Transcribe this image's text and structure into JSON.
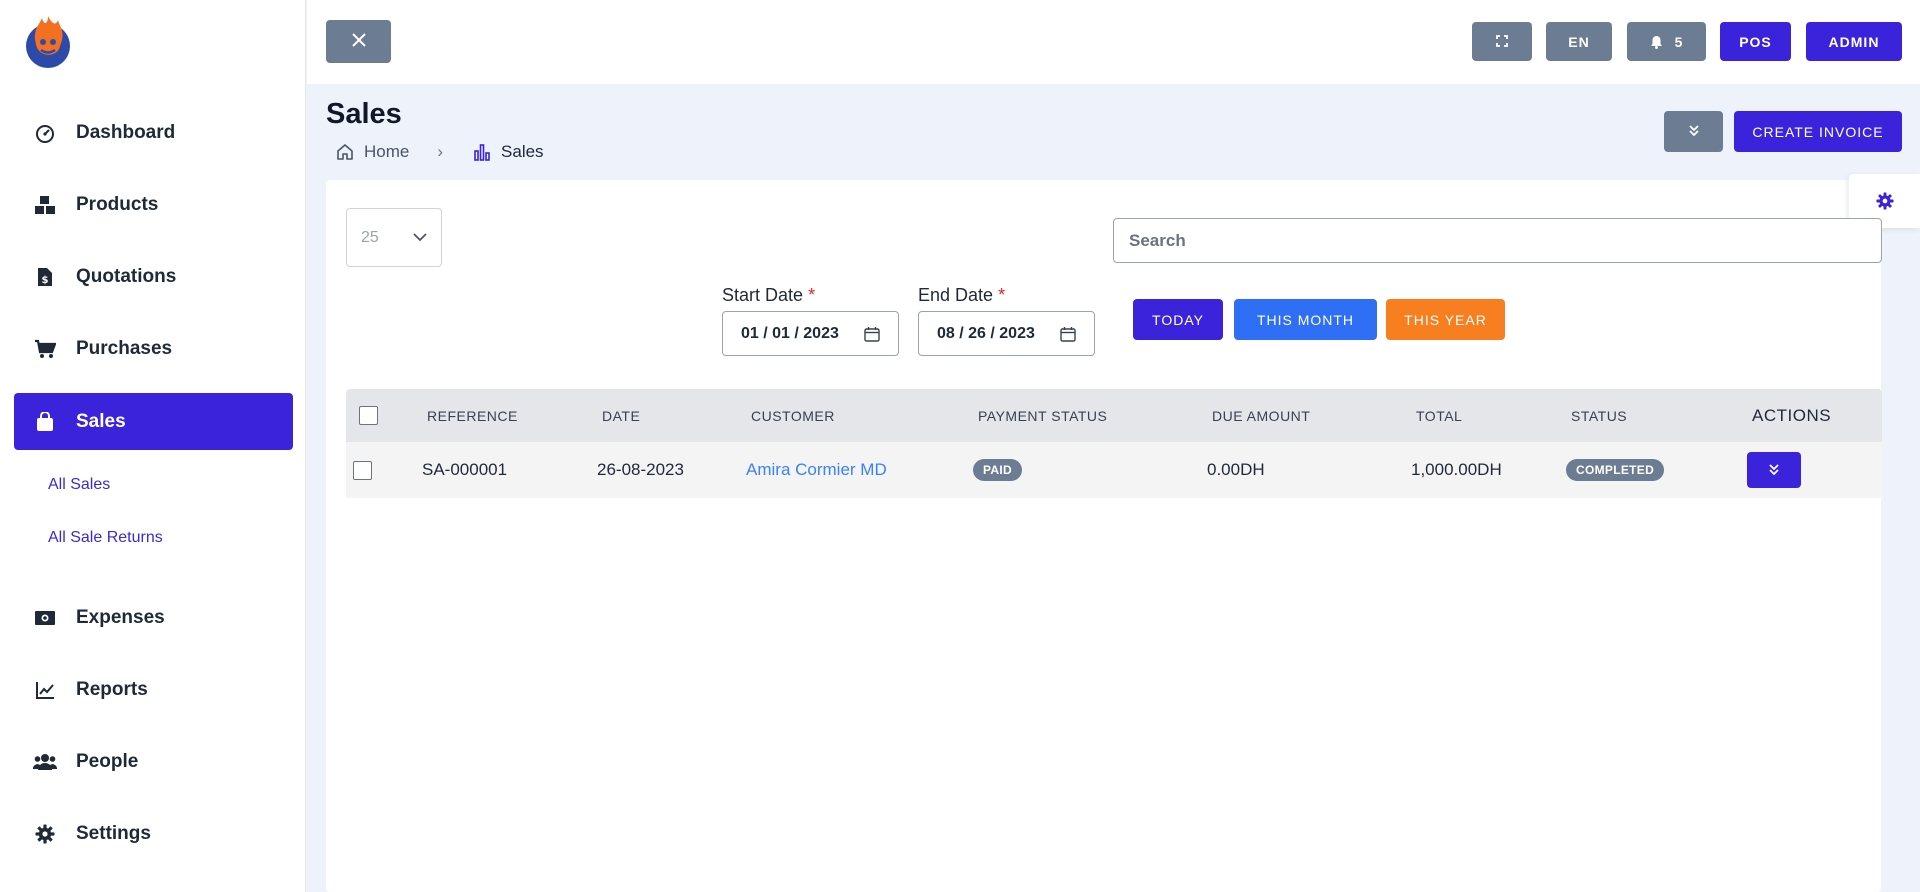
{
  "sidebar": {
    "items": [
      {
        "label": "Dashboard",
        "icon": "gauge-icon"
      },
      {
        "label": "Products",
        "icon": "boxes-icon"
      },
      {
        "label": "Quotations",
        "icon": "file-invoice-dollar-icon"
      },
      {
        "label": "Purchases",
        "icon": "cart-icon"
      },
      {
        "label": "Sales",
        "icon": "shopping-bag-icon"
      },
      {
        "label": "Expenses",
        "icon": "money-bill-icon"
      },
      {
        "label": "Reports",
        "icon": "line-chart-icon"
      },
      {
        "label": "People",
        "icon": "users-icon"
      },
      {
        "label": "Settings",
        "icon": "gear-icon"
      }
    ],
    "sales_sub": [
      "All Sales",
      "All Sale Returns"
    ]
  },
  "topbar": {
    "lang": "EN",
    "notifications": "5",
    "pos": "POS",
    "admin": "ADMIN"
  },
  "header": {
    "title": "Sales",
    "breadcrumb_home": "Home",
    "breadcrumb_current": "Sales",
    "create_label": "CREATE INVOICE"
  },
  "filters": {
    "per_page": "25",
    "search_placeholder": "Search",
    "start_label": "Start Date",
    "end_label": "End Date",
    "required_mark": "*",
    "start_value": "01 / 01 / 2023",
    "end_value": "08 / 26 / 2023",
    "today": "TODAY",
    "this_month": "THIS MONTH",
    "this_year": "THIS YEAR"
  },
  "table": {
    "headers": [
      "REFERENCE",
      "DATE",
      "CUSTOMER",
      "PAYMENT STATUS",
      "DUE AMOUNT",
      "TOTAL",
      "STATUS",
      "ACTIONS"
    ],
    "rows": [
      {
        "reference": "SA-000001",
        "date": "26-08-2023",
        "customer": "Amira Cormier MD",
        "payment_status": "PAID",
        "due_amount": "0.00DH",
        "total": "1,000.00DH",
        "status": "COMPLETED"
      }
    ]
  },
  "colors": {
    "accent": "#3b23dc",
    "blue": "#2f6ff5",
    "orange": "#f77f1f",
    "gray": "#6c7c92",
    "link": "#3b82f6"
  }
}
